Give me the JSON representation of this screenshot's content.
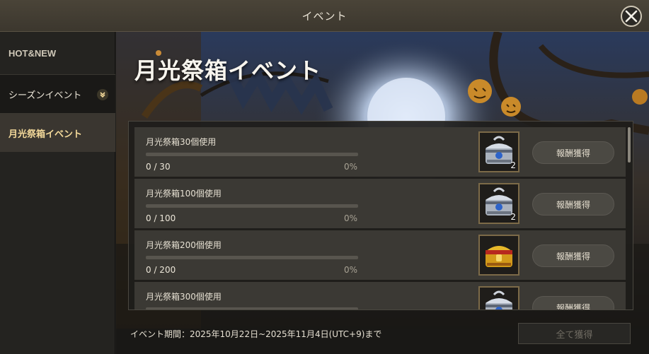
{
  "window": {
    "title": "イベント"
  },
  "sidebar": {
    "items": [
      {
        "label": "HOT&NEW"
      },
      {
        "label": "シーズンイベント"
      },
      {
        "label": "月光祭箱イベント"
      }
    ]
  },
  "event": {
    "title": "月光祭箱イベント",
    "claim_label": "報酬獲得",
    "rows": [
      {
        "label": "月光祭箱30個使用",
        "count": "0 / 30",
        "percent": "0%",
        "progress": 0,
        "reward_icon": "silver-chest-icon",
        "reward_qty": "2"
      },
      {
        "label": "月光祭箱100個使用",
        "count": "0 / 100",
        "percent": "0%",
        "progress": 0,
        "reward_icon": "silver-chest-icon",
        "reward_qty": "2"
      },
      {
        "label": "月光祭箱200個使用",
        "count": "0 / 200",
        "percent": "0%",
        "progress": 0,
        "reward_icon": "gold-chest-icon",
        "reward_qty": ""
      },
      {
        "label": "月光祭箱300個使用",
        "count": "",
        "percent": "",
        "progress": 0,
        "reward_icon": "silver-chest-icon",
        "reward_qty": ""
      }
    ],
    "period": "イベント期間：2025年10月22日~2025年11月4日(UTC+9)まで",
    "claim_all_label": "全て獲得"
  },
  "colors": {
    "accent_gold": "#f3d99a",
    "progress_fill": "#d8b25a"
  }
}
